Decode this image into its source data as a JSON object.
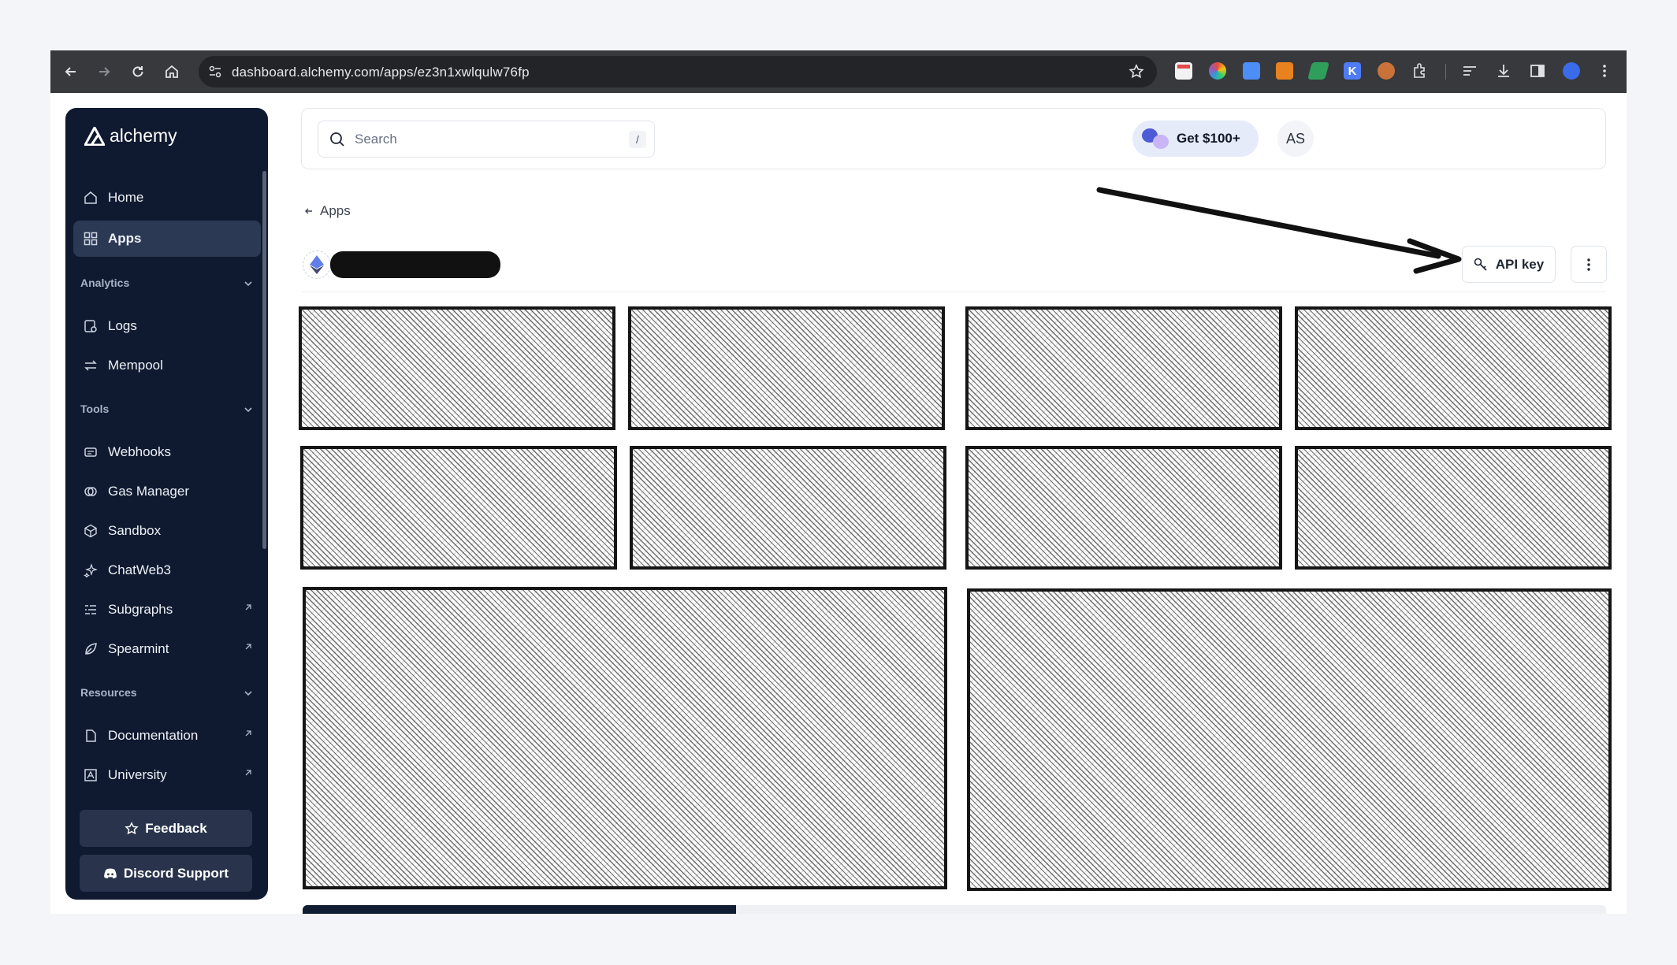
{
  "browser": {
    "url": "dashboard.alchemy.com/apps/ez3n1xwlqulw76fp"
  },
  "sidebar": {
    "brand": "alchemy",
    "items": [
      {
        "label": "Home",
        "icon": "home-icon"
      },
      {
        "label": "Apps",
        "icon": "grid-icon",
        "active": true
      }
    ],
    "sections": {
      "analytics": {
        "title": "Analytics",
        "items": [
          {
            "label": "Logs",
            "icon": "logs-icon"
          },
          {
            "label": "Mempool",
            "icon": "arrows-swap-icon"
          }
        ]
      },
      "tools": {
        "title": "Tools",
        "items": [
          {
            "label": "Webhooks",
            "icon": "webhook-icon"
          },
          {
            "label": "Gas Manager",
            "icon": "gas-icon"
          },
          {
            "label": "Sandbox",
            "icon": "cube-icon"
          },
          {
            "label": "ChatWeb3",
            "icon": "sparkle-icon"
          },
          {
            "label": "Subgraphs",
            "icon": "list-icon",
            "external": true
          },
          {
            "label": "Spearmint",
            "icon": "leaf-icon",
            "external": true
          }
        ]
      },
      "resources": {
        "title": "Resources",
        "items": [
          {
            "label": "Documentation",
            "icon": "document-icon",
            "external": true
          },
          {
            "label": "University",
            "icon": "university-icon",
            "external": true
          }
        ]
      }
    },
    "feedback_label": "Feedback",
    "discord_label": "Discord Support"
  },
  "topbar": {
    "search_placeholder": "Search",
    "search_shortcut": "/",
    "promo_label": "Get $100+",
    "avatar_initials": "AS"
  },
  "page": {
    "breadcrumb": "Apps",
    "api_key_label": "API key"
  },
  "colors": {
    "sidebar_bg": "#0f1a30",
    "active_item_bg": "#2c3954",
    "promo_bg": "#e6ebfa"
  }
}
